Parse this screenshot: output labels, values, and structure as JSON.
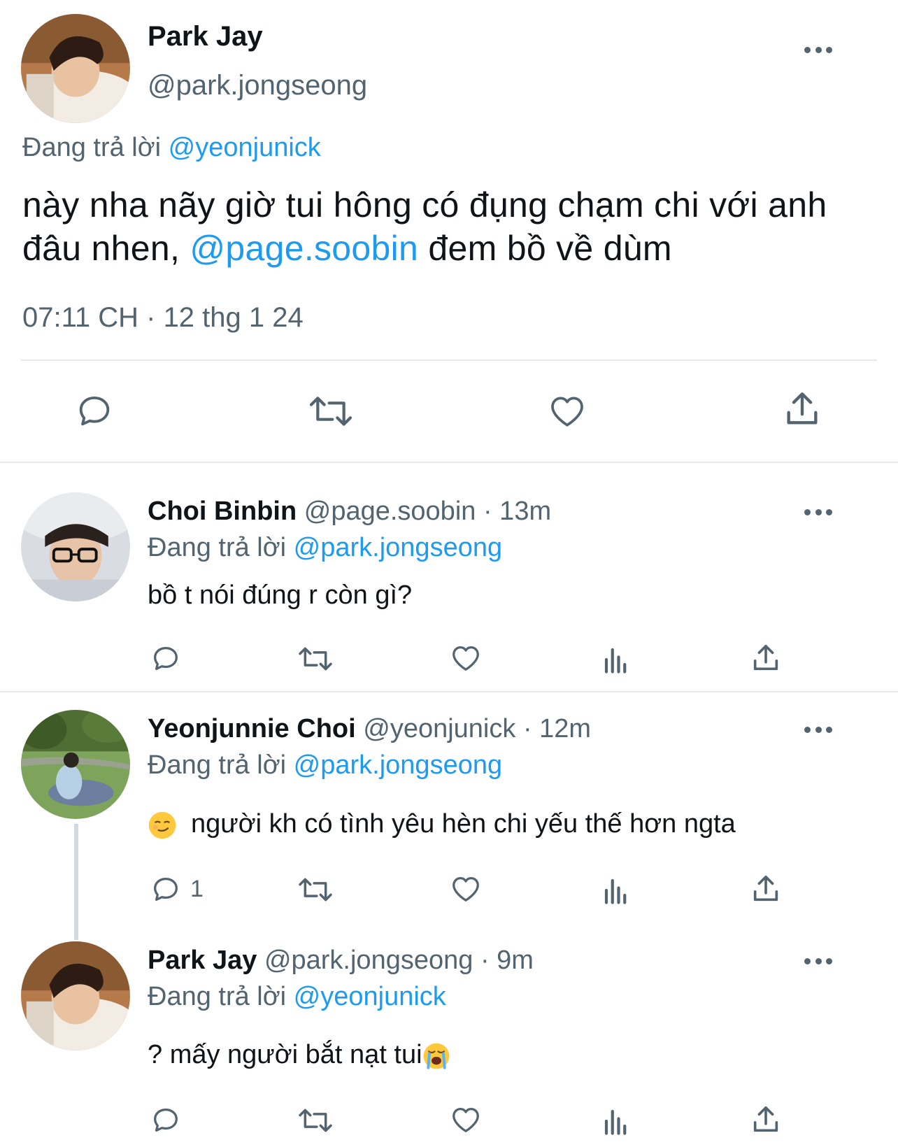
{
  "main_tweet": {
    "avatar_icon": "user-avatar",
    "name": "Park Jay",
    "handle": "@park.jongseong",
    "replying_prefix": "Đang trả lời",
    "replying_to": "@yeonjunick",
    "text_part1": "này nha nãy giờ tui hông có đụng chạm chi với anh đâu nhen, ",
    "text_mention": "@page.soobin",
    "text_part2": " đem bồ về dùm",
    "timestamp": "07:11 CH · 12 thg 1 24"
  },
  "replies": [
    {
      "name": "Choi Binbin",
      "handle": "@page.soobin",
      "time": "· 13m",
      "replying_prefix": "Đang trả lời",
      "replying_to": "@park.jongseong",
      "text": "bồ t nói đúng r còn gì?",
      "reply_count": ""
    },
    {
      "name": "Yeonjunnie Choi",
      "handle": "@yeonjunick",
      "time": "· 12m",
      "replying_prefix": "Đang trả lời",
      "replying_to": "@park.jongseong",
      "text": "người kh có tình yêu hèn chi yếu thế hơn ngta",
      "emoji": "smirking-face",
      "reply_count": "1"
    },
    {
      "name": "Park Jay",
      "handle": "@park.jongseong",
      "time": "· 9m",
      "replying_prefix": "Đang trả lời",
      "replying_to": "@yeonjunick",
      "text": "? mấy người bắt nạt tui",
      "emoji": "loudly-crying-face",
      "reply_count": ""
    }
  ],
  "colors": {
    "link": "#1d9bf0",
    "muted": "#536471",
    "text": "#0f1419",
    "divider": "#e6e9eb"
  }
}
